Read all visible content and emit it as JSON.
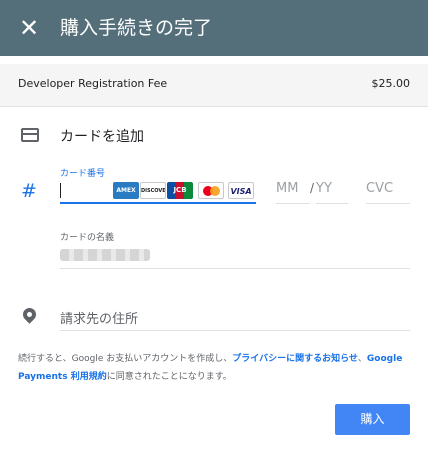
{
  "header": {
    "title": "購入手続きの完了",
    "close_icon": "close-icon"
  },
  "fee": {
    "label": "Developer Registration Fee",
    "amount": "$25.00"
  },
  "add_card": {
    "label": "カードを追加",
    "icon": "credit-card-icon"
  },
  "card_number": {
    "label": "カード番号",
    "value": "",
    "prefix_icon": "#",
    "brands": [
      "AMEX",
      "DISCOVER",
      "JCB",
      "MasterCard",
      "VISA"
    ]
  },
  "expiry": {
    "month_placeholder": "MM",
    "separator": "/",
    "year_placeholder": "YY"
  },
  "cvc": {
    "placeholder": "CVC"
  },
  "cardholder": {
    "label": "カードの名義"
  },
  "billing": {
    "placeholder": "請求先の住所",
    "icon": "location-pin-icon"
  },
  "terms": {
    "prefix": "続行すると、Google お支払いアカウントを作成し、",
    "link1": "プライバシーに関するお知らせ",
    "sep": "、",
    "link2": "Google Payments 利用規約",
    "suffix": "に同意されたことになります。"
  },
  "buy_button": {
    "label": "購入"
  },
  "colors": {
    "header": "#546e7a",
    "accent": "#1a73e8",
    "button": "#4285f4"
  }
}
